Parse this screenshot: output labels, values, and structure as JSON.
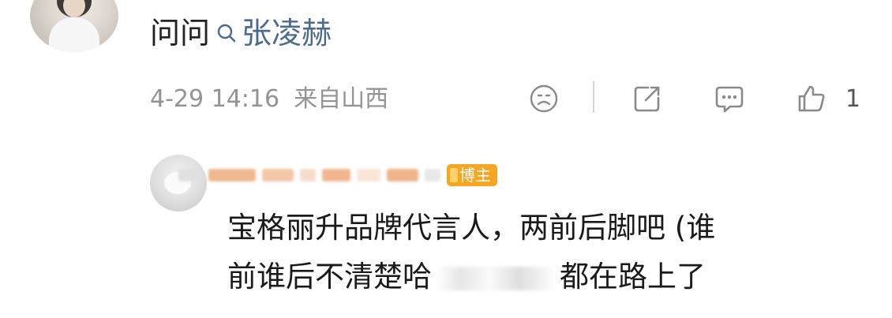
{
  "comment": {
    "text": "问问",
    "mention": "张凌赫",
    "time": "4-29 14:16",
    "location": "来自山西",
    "like_count": "1",
    "icons": [
      "dislike-face-icon",
      "share-icon",
      "comment-icon",
      "thumbs-up-icon"
    ]
  },
  "reply": {
    "badge": "博主",
    "line1": "宝格丽升品牌代言人，两前后脚吧 (谁",
    "line2a": "前谁后不清楚哈",
    "line2b": "都在路上了"
  },
  "colors": {
    "mention": "#4b6a8d",
    "meta": "#939393",
    "badge": "#f5a623",
    "icon": "#8a8a8a"
  }
}
